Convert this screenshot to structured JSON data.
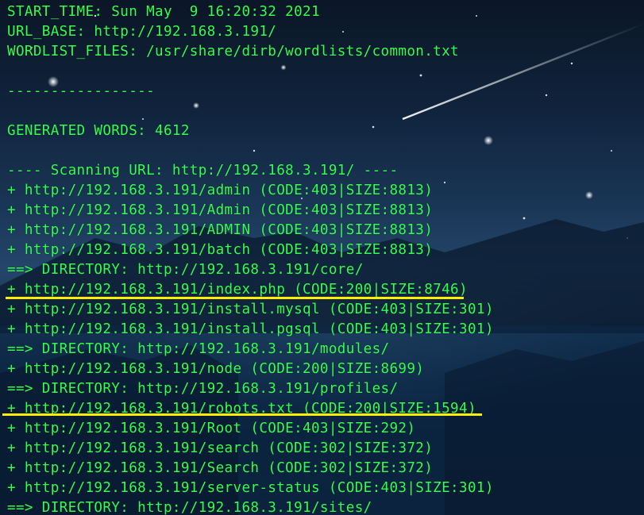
{
  "colors": {
    "terminal_text": "#33ff4f",
    "highlight_underline": "#ffee00",
    "background": "#10243d"
  },
  "terminal": {
    "lines": [
      "START_TIME: Sun May  9 16:20:32 2021",
      "URL_BASE: http://192.168.3.191/",
      "WORDLIST_FILES: /usr/share/dirb/wordlists/common.txt",
      "",
      "-----------------",
      "",
      "GENERATED WORDS: 4612",
      "",
      "---- Scanning URL: http://192.168.3.191/ ----",
      "+ http://192.168.3.191/admin (CODE:403|SIZE:8813)",
      "+ http://192.168.3.191/Admin (CODE:403|SIZE:8813)",
      "+ http://192.168.3.191/ADMIN (CODE:403|SIZE:8813)",
      "+ http://192.168.3.191/batch (CODE:403|SIZE:8813)",
      "==> DIRECTORY: http://192.168.3.191/core/",
      "+ http://192.168.3.191/index.php (CODE:200|SIZE:8746)",
      "+ http://192.168.3.191/install.mysql (CODE:403|SIZE:301)",
      "+ http://192.168.3.191/install.pgsql (CODE:403|SIZE:301)",
      "==> DIRECTORY: http://192.168.3.191/modules/",
      "+ http://192.168.3.191/node (CODE:200|SIZE:8699)",
      "==> DIRECTORY: http://192.168.3.191/profiles/",
      "+ http://192.168.3.191/robots.txt (CODE:200|SIZE:1594)",
      "+ http://192.168.3.191/Root (CODE:403|SIZE:292)",
      "+ http://192.168.3.191/search (CODE:302|SIZE:372)",
      "+ http://192.168.3.191/Search (CODE:302|SIZE:372)",
      "+ http://192.168.3.191/server-status (CODE:403|SIZE:301)",
      "==> DIRECTORY: http://192.168.3.191/sites/"
    ]
  }
}
